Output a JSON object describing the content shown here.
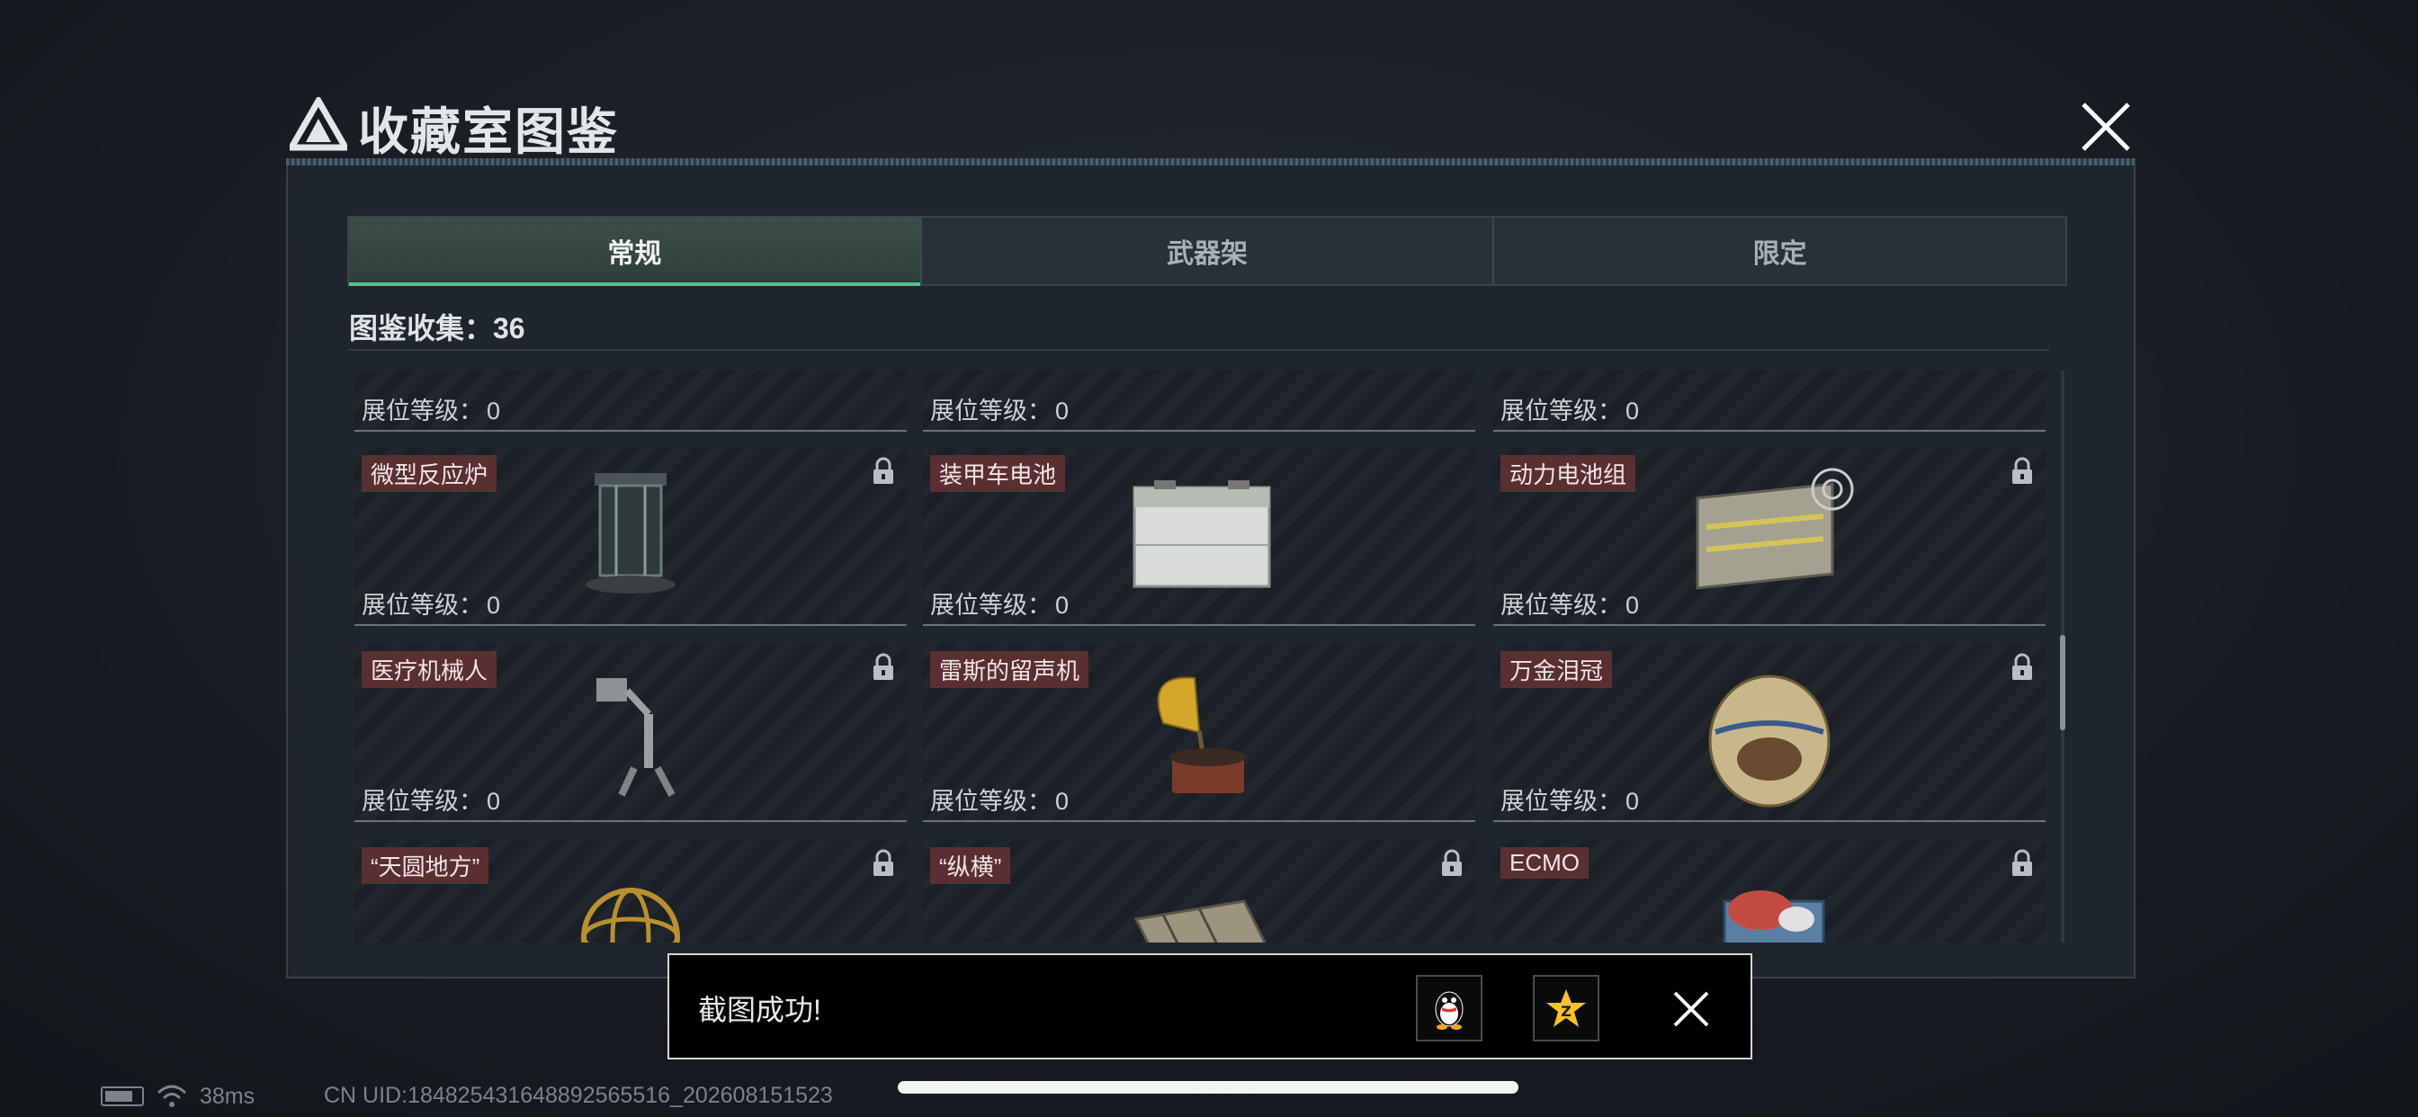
{
  "modal": {
    "title": "收藏室图鉴"
  },
  "tabs": [
    {
      "label": "常规",
      "active": true
    },
    {
      "label": "武器架",
      "active": false
    },
    {
      "label": "限定",
      "active": false
    }
  ],
  "collection": {
    "count_text": "图鉴收集：36"
  },
  "level_label": "展位等级：",
  "cards": [
    {
      "name": "",
      "level": "0",
      "locked": false,
      "art": "partial-item"
    },
    {
      "name": "",
      "level": "0",
      "locked": false,
      "art": "partial-item"
    },
    {
      "name": "",
      "level": "0",
      "locked": false,
      "art": "partial-item"
    },
    {
      "name": "微型反应炉",
      "level": "0",
      "locked": true,
      "art": "reactor"
    },
    {
      "name": "装甲车电池",
      "level": "0",
      "locked": false,
      "art": "battery"
    },
    {
      "name": "动力电池组",
      "level": "0",
      "locked": true,
      "art": "battery-pack"
    },
    {
      "name": "医疗机械人",
      "level": "0",
      "locked": true,
      "art": "robot"
    },
    {
      "name": "雷斯的留声机",
      "level": "0",
      "locked": false,
      "art": "gramophone"
    },
    {
      "name": "万金泪冠",
      "level": "0",
      "locked": true,
      "art": "egg"
    },
    {
      "name": "“天圆地方”",
      "level": "0",
      "locked": true,
      "art": "armillary"
    },
    {
      "name": "“纵横”",
      "level": "0",
      "locked": true,
      "art": "chessboard"
    },
    {
      "name": "ECMO",
      "level": "0",
      "locked": true,
      "art": "ecmo"
    }
  ],
  "toast": {
    "message": "截图成功!",
    "share_qq_icon": "qq-penguin-icon",
    "share_qzone_icon": "qzone-star-icon"
  },
  "status": {
    "ping": "38ms",
    "uid": "CN UID:184825431648892565516_202608151523"
  },
  "colors": {
    "accent_tab": "#4cc48e",
    "name_tag_bg": "#5a2f31"
  }
}
